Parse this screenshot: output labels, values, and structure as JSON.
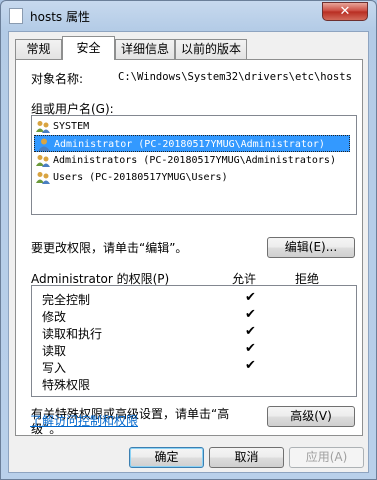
{
  "window": {
    "title": "hosts 属性",
    "close_glyph": "✕"
  },
  "tabs": [
    {
      "label": "常规",
      "active": false
    },
    {
      "label": "安全",
      "active": true
    },
    {
      "label": "详细信息",
      "active": false
    },
    {
      "label": "以前的版本",
      "active": false
    }
  ],
  "object": {
    "label": "对象名称:",
    "value": "C:\\Windows\\System32\\drivers\\etc\\hosts"
  },
  "groups": {
    "label": "组或用户名(G):",
    "items": [
      {
        "name": "SYSTEM",
        "selected": false
      },
      {
        "name": "Administrator (PC-20180517YMUG\\Administrator)",
        "selected": true
      },
      {
        "name": "Administrators (PC-20180517YMUG\\Administrators)",
        "selected": false
      },
      {
        "name": "Users (PC-20180517YMUG\\Users)",
        "selected": false
      }
    ]
  },
  "edit": {
    "hint": "要更改权限，请单击“编辑”。",
    "button": "编辑(E)..."
  },
  "permissions": {
    "title": "Administrator 的权限(P)",
    "allow_label": "允许",
    "deny_label": "拒绝",
    "check_glyph": "✔",
    "rows": [
      {
        "name": "完全控制",
        "allow": true,
        "deny": false
      },
      {
        "name": "修改",
        "allow": true,
        "deny": false
      },
      {
        "name": "读取和执行",
        "allow": true,
        "deny": false
      },
      {
        "name": "读取",
        "allow": true,
        "deny": false
      },
      {
        "name": "写入",
        "allow": true,
        "deny": false
      },
      {
        "name": "特殊权限",
        "allow": false,
        "deny": false
      }
    ]
  },
  "advanced": {
    "hint_line1": "有关特殊权限或高级设置，请单击“高",
    "hint_line2": "级”。",
    "button": "高级(V)"
  },
  "link": "了解访问控制和权限",
  "footer": {
    "ok": "确定",
    "cancel": "取消",
    "apply": "应用(A)"
  }
}
